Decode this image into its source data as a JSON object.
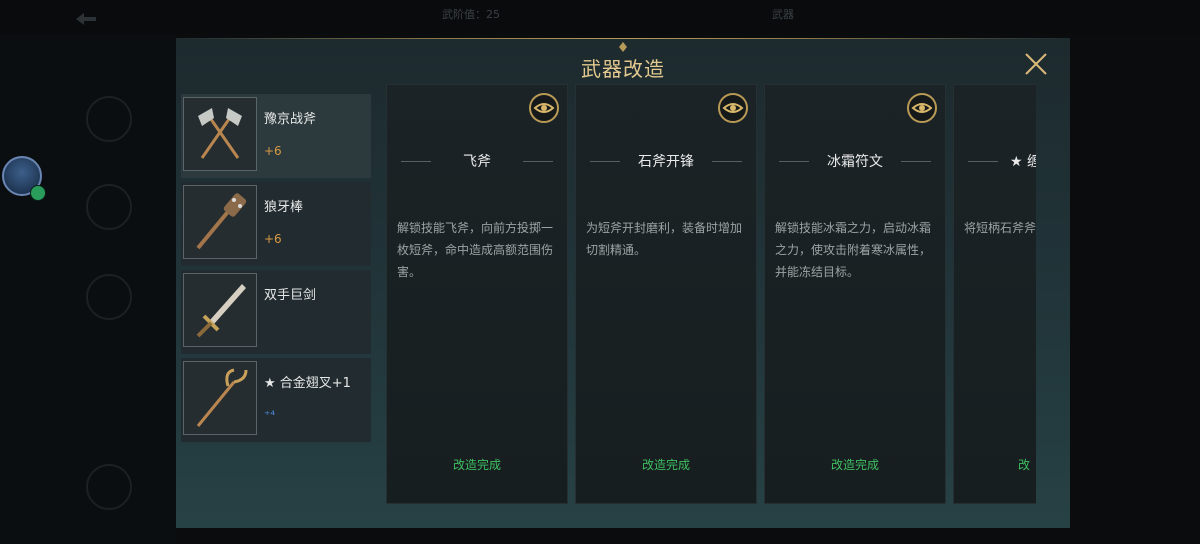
{
  "hud": {
    "top_text_1": "武阶值：25",
    "top_text_2": "武器"
  },
  "modal": {
    "title": "武器改造"
  },
  "weapons": [
    {
      "name": "豫京战斧",
      "level": "+6"
    },
    {
      "name": "狼牙棒",
      "level": "+6"
    },
    {
      "name": "双手巨剑",
      "level": ""
    },
    {
      "name": "★ 合金翅叉+1",
      "level": "⁺⁴"
    }
  ],
  "cards": [
    {
      "title": "飞斧",
      "desc": "解锁技能飞斧，向前方投掷一枚短斧，命中造成高额范围伤害。",
      "status": "改造完成"
    },
    {
      "title": "石斧开锋",
      "desc": "为短斧开封磨利，装备时增加切割精通。",
      "status": "改造完成"
    },
    {
      "title": "冰霜符文",
      "desc": "解锁技能冰霜之力，启动冰霜之力，使攻击附着寒冰属性，并能冻结目标。",
      "status": "改造完成"
    },
    {
      "title": "★ 缠",
      "desc": "将短柄石斧斧，大幅提升力。",
      "status": "改"
    }
  ],
  "colors": {
    "accent_gold": "#b99a55",
    "status_green": "#3fbf61",
    "level_orange": "#d99a43"
  },
  "icons": [
    "back-icon",
    "close-icon",
    "eye-icon",
    "axe-icon",
    "mace-icon",
    "sword-icon",
    "trident-icon"
  ]
}
